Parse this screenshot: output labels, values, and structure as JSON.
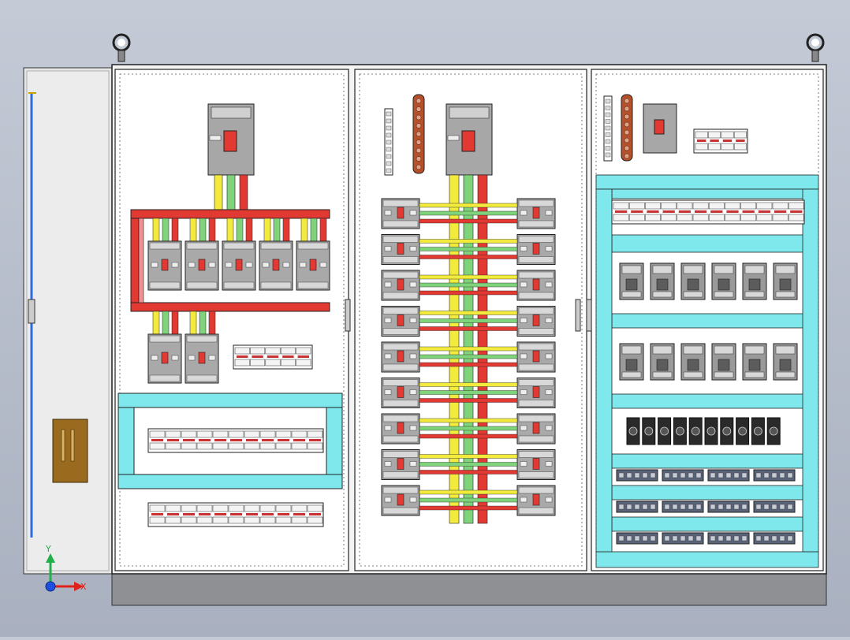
{
  "viewport": {
    "background_colors": [
      "#c4cad6",
      "#a9b0bf"
    ]
  },
  "triad": {
    "x_label": "X",
    "y_label": "Y",
    "x_color": "#e0201a",
    "y_color": "#22b04a",
    "z_color": "#1f4fe0"
  },
  "colors": {
    "phase_a": "#f2ea3c",
    "phase_b": "#7fd37a",
    "phase_c": "#e23a32",
    "neutral_bar": "#f09090",
    "cable_duct": "#7ee8ec",
    "cabinet_base": "#8f9094",
    "door_hinge_panel": "#e6e6e6",
    "handle": "#9a6a1e"
  },
  "counts": {
    "left_branch_breakers": 5,
    "left_lower_breakers": 2,
    "middle_breaker_rows": 9,
    "right_contactors_per_row": 6,
    "right_terminal_relays": 10
  }
}
